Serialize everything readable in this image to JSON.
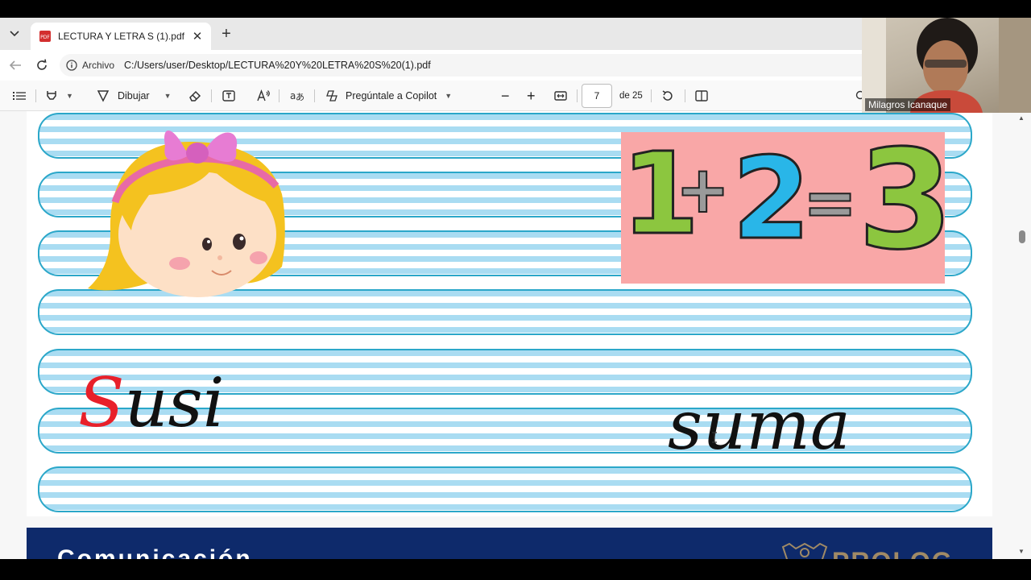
{
  "tab": {
    "title": "LECTURA Y LETRA S (1).pdf",
    "close": "✕",
    "new_tab": "+"
  },
  "address": {
    "label": "Archivo",
    "url": "C:/Users/user/Desktop/LECTURA%20Y%20LETRA%20S%20(1).pdf"
  },
  "toolbar": {
    "draw_label": "Dibujar",
    "copilot_label": "Pregúntale a Copilot",
    "zoom_out": "−",
    "zoom_in": "+",
    "page_current": "7",
    "page_total": "de 25"
  },
  "document": {
    "equation": {
      "n1": "1",
      "plus": "+",
      "n2": "2",
      "equals": "=",
      "result": "3"
    },
    "word_left_initial": "S",
    "word_left_rest": "usi",
    "word_right": "suma",
    "next_page_title": "Comunicación",
    "next_page_brand": "PROLOG"
  },
  "webcam": {
    "participant_name": "Milagros Icanaque"
  },
  "colors": {
    "accent_red": "#e8202a",
    "stripe_blue": "#a9dcf2",
    "stripe_border": "#2ba7c9",
    "equation_bg": "#f9a7a7",
    "green": "#8cc63f",
    "cyan": "#29b6e8"
  }
}
